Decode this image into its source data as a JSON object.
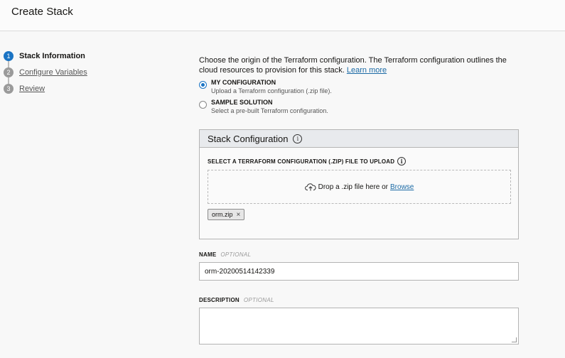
{
  "header": {
    "title": "Create Stack"
  },
  "steps": [
    {
      "num": "1",
      "label": "Stack Information"
    },
    {
      "num": "2",
      "label": "Configure Variables"
    },
    {
      "num": "3",
      "label": "Review"
    }
  ],
  "intro": {
    "text": "Choose the origin of the Terraform configuration. The Terraform configuration outlines the cloud resources to provision for this stack.",
    "link": "Learn more"
  },
  "origin": {
    "selected": "my_configuration",
    "options": [
      {
        "title": "MY CONFIGURATION",
        "desc": "Upload a Terraform configuration (.zip file)."
      },
      {
        "title": "SAMPLE SOLUTION",
        "desc": "Select a pre-built Terraform configuration."
      }
    ]
  },
  "stack_config": {
    "title": "Stack Configuration",
    "upload_label": "SELECT A TERRAFORM CONFIGURATION (.ZIP) FILE TO UPLOAD",
    "drop_text": "Drop a .zip file here or",
    "browse": "Browse",
    "file": "orm.zip",
    "remove": "×"
  },
  "info_glyph": "i",
  "name_field": {
    "label": "NAME",
    "optional": "OPTIONAL",
    "value": "orm-20200514142339"
  },
  "description_field": {
    "label": "DESCRIPTION",
    "optional": "OPTIONAL",
    "value": ""
  },
  "colors": {
    "accent": "#1b74c4",
    "link": "#1b6aa5"
  }
}
